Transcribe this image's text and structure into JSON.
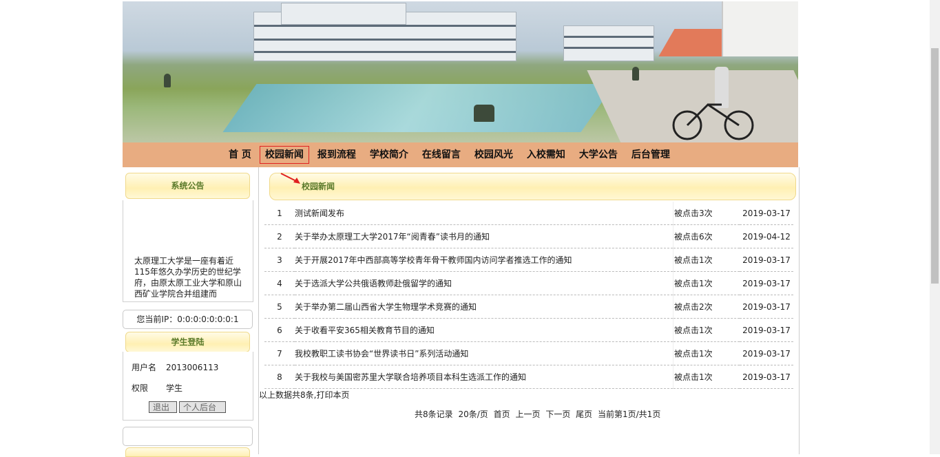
{
  "nav": {
    "items": [
      "首 页",
      "校园新闻",
      "报到流程",
      "学校简介",
      "在线留言",
      "校园风光",
      "入校需知",
      "大学公告",
      "后台管理"
    ],
    "active_index": 1
  },
  "sidebar": {
    "announcement_title": "系统公告",
    "intro_text": "太原理工大学是一座有着近115年悠久办学历史的世纪学府，由原太原工业大学和原山西矿业学院合并组建而",
    "ip_text": "您当前IP：0:0:0:0:0:0:0:1",
    "login_title": "学生登陆",
    "username_label": "用户名",
    "username_value": "2013006113",
    "role_label": "权限",
    "role_value": "学生",
    "logout_button": "退出",
    "dashboard_button": "个人后台"
  },
  "main": {
    "section_title": "校园新闻",
    "news": [
      {
        "no": "1",
        "title": "测试新闻发布",
        "hits": "被点击3次",
        "date": "2019-03-17"
      },
      {
        "no": "2",
        "title": "关于举办太原理工大学2017年“阅青春”读书月的通知",
        "hits": "被点击6次",
        "date": "2019-04-12"
      },
      {
        "no": "3",
        "title": "关于开展2017年中西部高等学校青年骨干教师国内访问学者推选工作的通知",
        "hits": "被点击1次",
        "date": "2019-03-17"
      },
      {
        "no": "4",
        "title": "关于选派大学公共俄语教师赴俄留学的通知",
        "hits": "被点击1次",
        "date": "2019-03-17"
      },
      {
        "no": "5",
        "title": "关于举办第二届山西省大学生物理学术竞赛的通知",
        "hits": "被点击2次",
        "date": "2019-03-17"
      },
      {
        "no": "6",
        "title": "关于收看平安365相关教育节目的通知",
        "hits": "被点击1次",
        "date": "2019-03-17"
      },
      {
        "no": "7",
        "title": "我校教职工读书协会“世界读书日”系列活动通知",
        "hits": "被点击1次",
        "date": "2019-03-17"
      },
      {
        "no": "8",
        "title": "关于我校与美国密苏里大学联合培养项目本科生选派工作的通知",
        "hits": "被点击1次",
        "date": "2019-03-17"
      }
    ],
    "footnote": "以上数据共8条,打印本页",
    "pager": {
      "total": "共8条记录",
      "per_page": "20条/页",
      "first": "首页",
      "prev": "上一页",
      "next": "下一页",
      "last": "尾页",
      "current": "当前第1页/共1页"
    }
  },
  "colors": {
    "nav_bg": "#e8ac81",
    "header_text": "#5a7a2a",
    "active_outline": "#e02020"
  }
}
